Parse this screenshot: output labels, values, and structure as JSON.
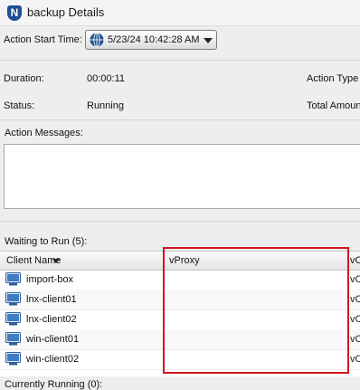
{
  "window": {
    "title": "backup Details",
    "logo_letter": "N"
  },
  "action_start": {
    "label": "Action Start Time:",
    "value": "5/23/24 10:42:28 AM"
  },
  "summary": {
    "duration_label": "Duration:",
    "duration_value": "00:00:11",
    "status_label": "Status:",
    "status_value": "Running",
    "action_type_label": "Action Type",
    "total_amount_label": "Total Amoun"
  },
  "messages": {
    "label": "Action Messages:",
    "text": ""
  },
  "waiting": {
    "label": "Waiting to Run (5):",
    "columns": {
      "client": "Client Name",
      "vproxy": "vProxy",
      "next": "vC"
    },
    "rows": [
      {
        "client": "import-box",
        "vproxy": "",
        "next": "vC"
      },
      {
        "client": "lnx-client01",
        "vproxy": "",
        "next": "vC"
      },
      {
        "client": "lnx-client02",
        "vproxy": "",
        "next": "vC"
      },
      {
        "client": "win-client01",
        "vproxy": "",
        "next": "vC"
      },
      {
        "client": "win-client02",
        "vproxy": "",
        "next": "vC"
      }
    ]
  },
  "currently_running": {
    "label": "Currently Running (0):"
  },
  "colors": {
    "highlight": "#d4151c",
    "logo": "#1f4e96"
  },
  "icons": {
    "app": "networker-logo-icon",
    "time": "globe-icon",
    "client": "computer-icon"
  }
}
